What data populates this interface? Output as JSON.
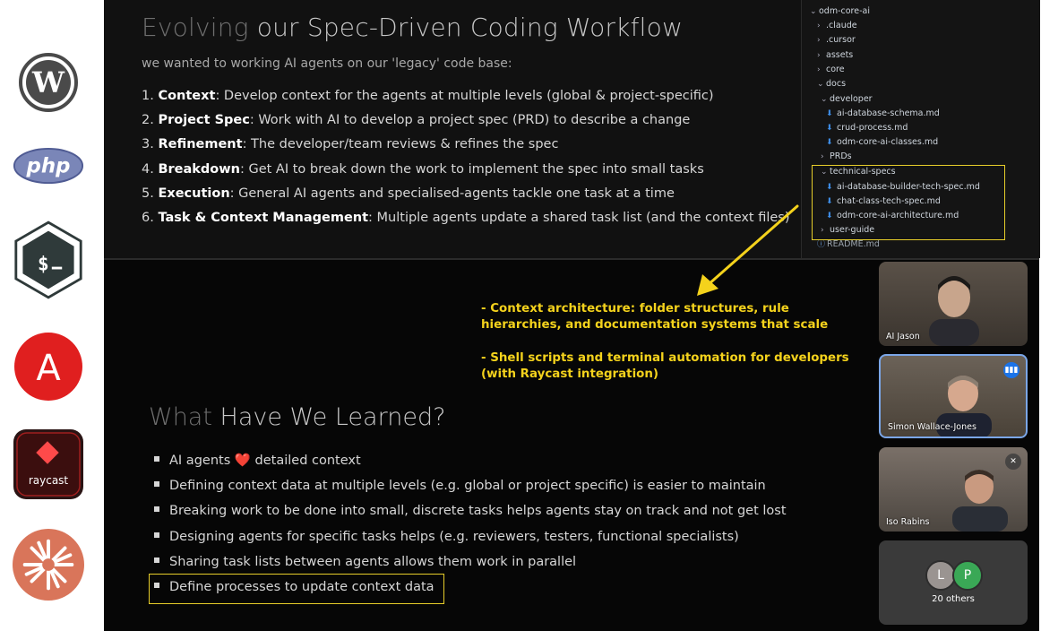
{
  "sidebar_logos": [
    {
      "name": "wordpress",
      "label": ""
    },
    {
      "name": "php",
      "label": "php"
    },
    {
      "name": "bash",
      "label": "$"
    },
    {
      "name": "ansible",
      "label": "A"
    },
    {
      "name": "raycast",
      "label": "raycast"
    },
    {
      "name": "claude",
      "label": ""
    }
  ],
  "top_slide": {
    "title_dim": "Evolving",
    "title_rest": " our Spec-Driven Coding Workflow",
    "subtitle": "we wanted to working AI agents on our 'legacy' code base:",
    "steps": [
      {
        "num": "1.",
        "bold": "Context",
        "text": ": Develop context for the agents at multiple levels (global & project-specific)"
      },
      {
        "num": "2.",
        "bold": "Project Spec",
        "text": ": Work with AI to develop a project spec (PRD) to describe a change"
      },
      {
        "num": "3.",
        "bold": "Refinement",
        "text": ": The developer/team reviews & refines the spec"
      },
      {
        "num": "4.",
        "bold": "Breakdown",
        "text": ": Get AI to break down the work to implement the spec into small tasks"
      },
      {
        "num": "5.",
        "bold": "Execution",
        "text": ": General AI agents and specialised-agents tackle one task at a time"
      },
      {
        "num": "6.",
        "bold": "Task & Context Management",
        "text": ": Multiple agents update a shared task list (and the context files)"
      }
    ]
  },
  "file_tree": {
    "root": "odm-core-ai",
    "items": [
      {
        "type": "folder",
        "open": false,
        "label": ".claude"
      },
      {
        "type": "folder",
        "open": false,
        "label": ".cursor"
      },
      {
        "type": "folder",
        "open": false,
        "label": "assets"
      },
      {
        "type": "folder",
        "open": false,
        "label": "core"
      },
      {
        "type": "folder",
        "open": true,
        "label": "docs"
      },
      {
        "type": "folder",
        "open": true,
        "label": "developer"
      },
      {
        "type": "file",
        "label": "ai-database-schema.md"
      },
      {
        "type": "file",
        "label": "crud-process.md"
      },
      {
        "type": "file",
        "label": "odm-core-ai-classes.md"
      },
      {
        "type": "folder",
        "open": false,
        "label": "PRDs"
      },
      {
        "type": "folder",
        "open": true,
        "label": "technical-specs"
      },
      {
        "type": "file",
        "label": "ai-database-builder-tech-spec.md"
      },
      {
        "type": "file",
        "label": "chat-class-tech-spec.md"
      },
      {
        "type": "file",
        "label": "odm-core-ai-architecture.md"
      },
      {
        "type": "folder",
        "open": false,
        "label": "user-guide"
      },
      {
        "type": "info",
        "label": "README.md"
      }
    ]
  },
  "annotation": {
    "lines": [
      "- Context architecture: folder structures, rule",
      "hierarchies, and documentation systems that scale",
      "- Shell scripts and terminal automation for developers",
      "(with Raycast integration)"
    ]
  },
  "bottom_slide": {
    "title_dim": "What",
    "title_rest": " Have We Learned?",
    "items": [
      {
        "pre": "AI agents ",
        "heart": "❤️",
        "post": " detailed context"
      },
      {
        "pre": "Defining context data at multiple levels (e.g. global or project specific) is easier to maintain"
      },
      {
        "pre": "Breaking work to be done into small, discrete tasks helps agents stay on track and not get lost"
      },
      {
        "pre": "Designing agents for specific tasks helps (e.g. reviewers, testers, functional specialists)"
      },
      {
        "pre": "Sharing task lists between agents allows them work in parallel"
      },
      {
        "pre": "Define processes to update context data"
      }
    ]
  },
  "participants": [
    {
      "name": "AI Jason",
      "status": ""
    },
    {
      "name": "Simon Wallace-Jones",
      "status": "speaking"
    },
    {
      "name": "Iso Rabins",
      "status": "muted"
    }
  ],
  "others": {
    "avatars": [
      {
        "initial": "L",
        "color": "#9a9491"
      },
      {
        "initial": "P",
        "color": "#3aa856"
      }
    ],
    "label": "20 others"
  }
}
